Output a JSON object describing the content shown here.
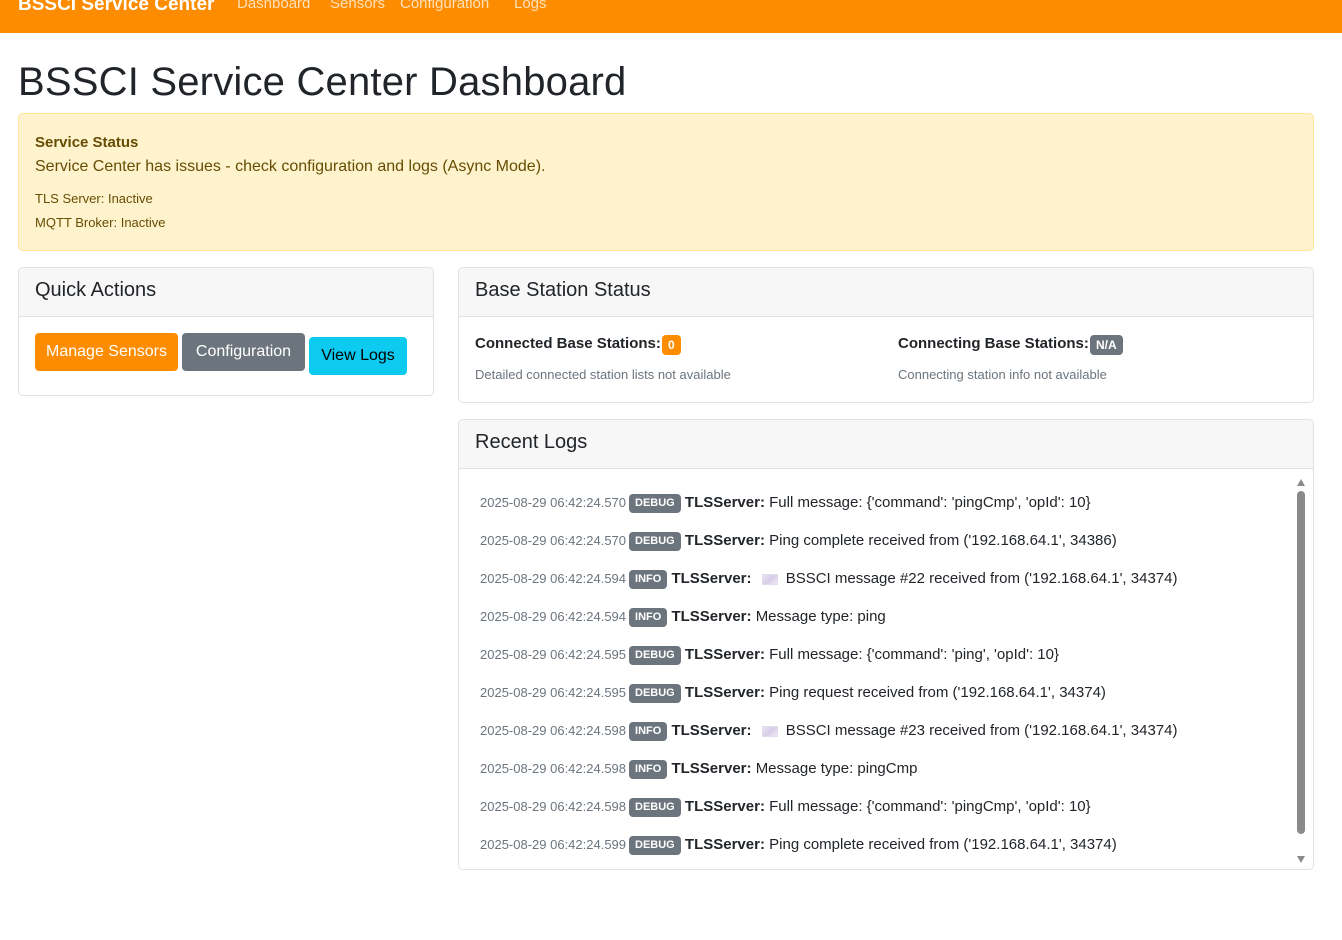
{
  "navbar": {
    "brand": "BSSCI Service Center",
    "links": [
      "Dashboard",
      "Sensors",
      "Configuration",
      "Logs"
    ]
  },
  "page": {
    "title": "BSSCI Service Center Dashboard"
  },
  "service_status": {
    "title": "Service Status",
    "message": "Service Center has issues - check configuration and logs (Async Mode).",
    "tls_server": "TLS Server: Inactive",
    "mqtt_broker": "MQTT Broker: Inactive"
  },
  "quick_actions": {
    "title": "Quick Actions",
    "manage_sensors": "Manage Sensors",
    "configuration": "Configuration",
    "view_logs": "View Logs"
  },
  "base_station": {
    "title": "Base Station Status",
    "connected_label": "Connected Base Stations:",
    "connected_count": "0",
    "connected_note": "Detailed connected station lists not available",
    "connecting_label": "Connecting Base Stations:",
    "connecting_count": "N/A",
    "connecting_note": "Connecting station info not available"
  },
  "recent_logs": {
    "title": "Recent Logs",
    "entries": [
      {
        "ts": "2025-08-29 06:42:24.570",
        "level": "DEBUG",
        "source": "TLSServer:",
        "message": "Full message: {'command': 'pingCmp', 'opId': 10}",
        "icon": ""
      },
      {
        "ts": "2025-08-29 06:42:24.570",
        "level": "DEBUG",
        "source": "TLSServer:",
        "message": "Ping complete received from ('192.168.64.1', 34386)",
        "icon": ""
      },
      {
        "ts": "2025-08-29 06:42:24.594",
        "level": "INFO",
        "source": "TLSServer:",
        "message": "BSSCI message #22 received from ('192.168.64.1', 34374)",
        "icon": "envelope-icon"
      },
      {
        "ts": "2025-08-29 06:42:24.594",
        "level": "INFO",
        "source": "TLSServer:",
        "message": "Message type: ping",
        "icon": ""
      },
      {
        "ts": "2025-08-29 06:42:24.595",
        "level": "DEBUG",
        "source": "TLSServer:",
        "message": "Full message: {'command': 'ping', 'opId': 10}",
        "icon": ""
      },
      {
        "ts": "2025-08-29 06:42:24.595",
        "level": "DEBUG",
        "source": "TLSServer:",
        "message": "Ping request received from ('192.168.64.1', 34374)",
        "icon": ""
      },
      {
        "ts": "2025-08-29 06:42:24.598",
        "level": "INFO",
        "source": "TLSServer:",
        "message": "BSSCI message #23 received from ('192.168.64.1', 34374)",
        "icon": "envelope-icon"
      },
      {
        "ts": "2025-08-29 06:42:24.598",
        "level": "INFO",
        "source": "TLSServer:",
        "message": "Message type: pingCmp",
        "icon": ""
      },
      {
        "ts": "2025-08-29 06:42:24.598",
        "level": "DEBUG",
        "source": "TLSServer:",
        "message": "Full message: {'command': 'pingCmp', 'opId': 10}",
        "icon": ""
      },
      {
        "ts": "2025-08-29 06:42:24.599",
        "level": "DEBUG",
        "source": "TLSServer:",
        "message": "Ping complete received from ('192.168.64.1', 34374)",
        "icon": ""
      }
    ]
  },
  "colors": {
    "brand_orange": "#fd8c00",
    "secondary_gray": "#6c757d",
    "info_cyan": "#0dcaf0",
    "warning_bg": "#fff3cd"
  }
}
